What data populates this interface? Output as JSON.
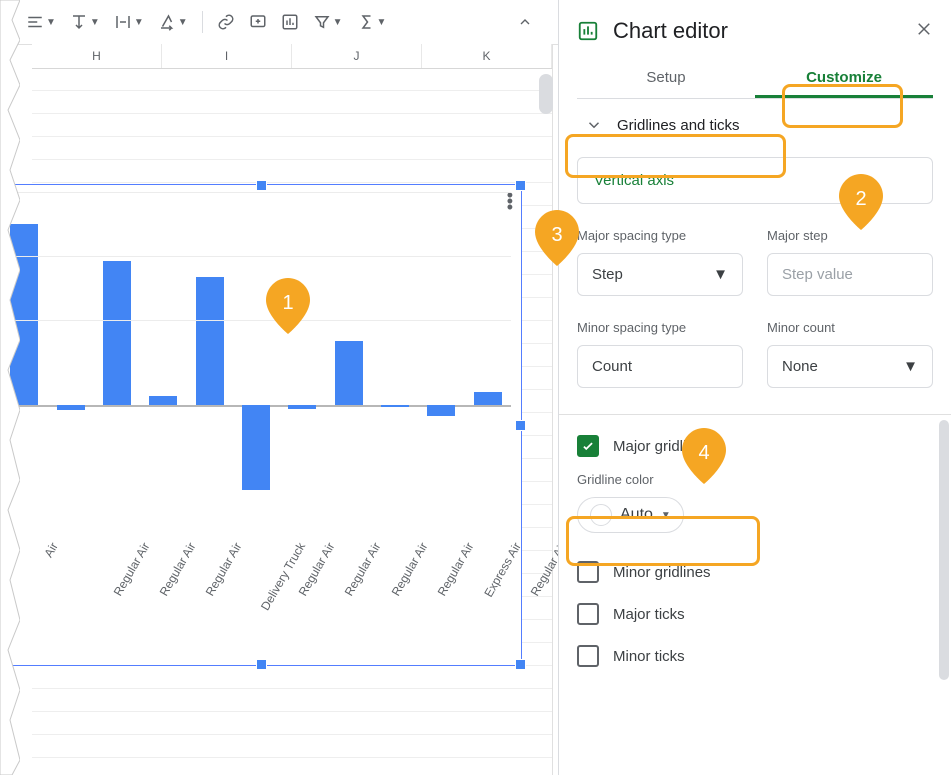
{
  "toolbar": {
    "icons": [
      "align-menu",
      "valign-menu",
      "wrap-menu",
      "rotate-menu",
      "link",
      "comment",
      "insert-chart",
      "filter",
      "functions"
    ]
  },
  "columns": [
    "H",
    "I",
    "J",
    "K"
  ],
  "panel": {
    "title": "Chart editor",
    "tabs": {
      "setup": "Setup",
      "customize": "Customize",
      "active": "customize"
    },
    "section": "Gridlines and ticks",
    "axis_label": "Vertical axis",
    "major_spacing_type_label": "Major spacing type",
    "major_spacing_type_value": "Step",
    "major_step_label": "Major step",
    "major_step_placeholder": "Step value",
    "minor_spacing_type_label": "Minor spacing type",
    "minor_spacing_type_value": "Count",
    "minor_count_label": "Minor count",
    "minor_count_value": "None",
    "major_gridlines_label": "Major gridlines",
    "major_gridlines_checked": true,
    "gridline_color_label": "Gridline color",
    "gridline_color_value": "Auto",
    "minor_gridlines_label": "Minor gridlines",
    "major_ticks_label": "Major ticks",
    "minor_ticks_label": "Minor ticks"
  },
  "annotations": {
    "p1": "1",
    "p2": "2",
    "p3": "3",
    "p4": "4"
  },
  "chart_data": {
    "type": "bar",
    "categories": [
      "Air",
      "Regular Air",
      "Regular Air",
      "Regular Air",
      "Delivery Truck",
      "Regular Air",
      "Regular Air",
      "Regular Air",
      "Regular Air",
      "Express Air",
      "Regular Air"
    ],
    "values": [
      170,
      -5,
      135,
      8,
      120,
      -80,
      -4,
      60,
      -2,
      -10,
      12
    ],
    "title": "",
    "xlabel": "",
    "ylabel": "",
    "ylim": [
      -100,
      200
    ],
    "gridlines": [
      200,
      140,
      80,
      0
    ]
  }
}
